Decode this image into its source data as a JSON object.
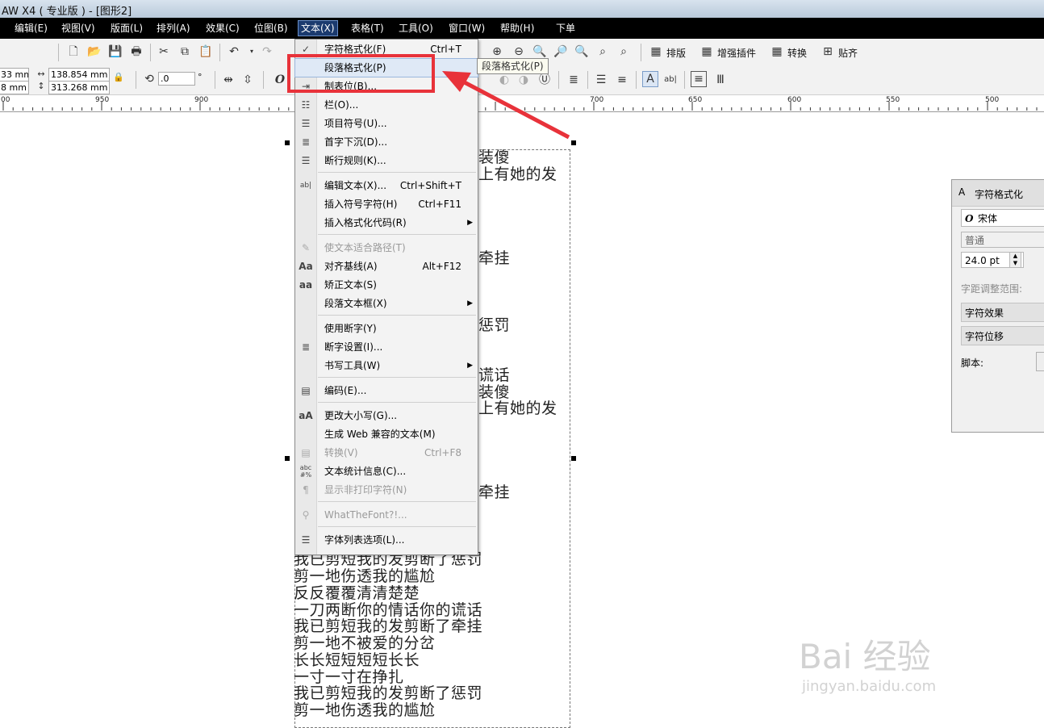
{
  "titlebar": {
    "title": "AW X4 ( 专业版 ) - [图形2]"
  },
  "menubar": {
    "items": [
      {
        "label": "编辑(E)"
      },
      {
        "label": "视图(V)"
      },
      {
        "label": "版面(L)"
      },
      {
        "label": "排列(A)"
      },
      {
        "label": "效果(C)"
      },
      {
        "label": "位图(B)"
      },
      {
        "label": "文本(X)"
      },
      {
        "label": "表格(T)"
      },
      {
        "label": "工具(O)"
      },
      {
        "label": "窗口(W)"
      },
      {
        "label": "帮助(H)"
      },
      {
        "label": "下单"
      }
    ]
  },
  "toolbar1": {
    "buttons": {
      "layout": "排版",
      "plugins": "增强插件",
      "convert": "转换",
      "snap": "贴齐"
    }
  },
  "toolbar2": {
    "pos_x": "33 mm",
    "pos_y": "8 mm",
    "width": "138.854 mm",
    "height": "313.268 mm",
    "rotation": ".0",
    "degree": "°"
  },
  "ruler": {
    "labels": [
      "00",
      "950",
      "900",
      "700",
      "650",
      "600",
      "550",
      "500"
    ]
  },
  "dropdown": {
    "items": [
      {
        "label": "字符格式化(F)",
        "shortcut": "Ctrl+T",
        "icon": "check-icon"
      },
      {
        "label": "段落格式化(P)",
        "shortcut": "",
        "icon": "paragraph-format-icon"
      },
      {
        "label": "制表位(B)...",
        "shortcut": "",
        "icon": "tab-stop-icon"
      },
      {
        "label": "栏(O)...",
        "shortcut": "",
        "icon": "columns-icon"
      },
      {
        "label": "项目符号(U)...",
        "shortcut": "",
        "icon": "bullets-icon"
      },
      {
        "label": "首字下沉(D)...",
        "shortcut": "",
        "icon": "drop-cap-icon"
      },
      {
        "label": "断行规则(K)...",
        "shortcut": "",
        "icon": "line-break-icon"
      },
      {
        "label": "编辑文本(X)...",
        "shortcut": "Ctrl+Shift+T",
        "icon": "edit-text-icon"
      },
      {
        "label": "插入符号字符(H)",
        "shortcut": "Ctrl+F11",
        "icon": ""
      },
      {
        "label": "插入格式化代码(R)",
        "shortcut": "",
        "icon": ""
      },
      {
        "label": "使文本适合路径(T)",
        "shortcut": "",
        "icon": "fit-path-icon"
      },
      {
        "label": "对齐基线(A)",
        "shortcut": "Alt+F12",
        "icon": "align-baseline-icon"
      },
      {
        "label": "矫正文本(S)",
        "shortcut": "",
        "icon": "straighten-text-icon"
      },
      {
        "label": "段落文本框(X)",
        "shortcut": "",
        "icon": ""
      },
      {
        "label": "使用断字(Y)",
        "shortcut": "",
        "icon": ""
      },
      {
        "label": "断字设置(I)...",
        "shortcut": "",
        "icon": "hyphenation-icon"
      },
      {
        "label": "书写工具(W)",
        "shortcut": "",
        "icon": ""
      },
      {
        "label": "编码(E)...",
        "shortcut": "",
        "icon": "encoding-icon"
      },
      {
        "label": "更改大小写(G)...",
        "shortcut": "",
        "icon": "change-case-icon"
      },
      {
        "label": "生成 Web 兼容的文本(M)",
        "shortcut": "",
        "icon": ""
      },
      {
        "label": "转换(V)",
        "shortcut": "Ctrl+F8",
        "icon": "convert-icon"
      },
      {
        "label": "文本统计信息(C)...",
        "shortcut": "",
        "icon": "statistics-icon"
      },
      {
        "label": "显示非打印字符(N)",
        "shortcut": "",
        "icon": "pilcrow-icon"
      },
      {
        "label": "WhatTheFont?!...",
        "shortcut": "",
        "icon": "whatthefont-icon"
      },
      {
        "label": "字体列表选项(L)...",
        "shortcut": "",
        "icon": "font-list-icon"
      }
    ]
  },
  "tooltip": {
    "text": "段落格式化(P)"
  },
  "document": {
    "lines_right": [
      "装傻",
      "上有她的发",
      "牵挂",
      "惩罚",
      "谎话",
      "装傻",
      "上有她的发",
      "牵挂"
    ],
    "lines_full": [
      "我已剪短我的发剪断了惩罚",
      "剪一地伤透我的尴尬",
      "反反覆覆清清楚楚",
      "一刀两断你的情话你的谎话",
      "我已剪短我的发剪断了牵挂",
      "剪一地不被爱的分岔",
      "长长短短短短长长",
      "一寸一寸在挣扎",
      "我已剪短我的发剪断了惩罚",
      "剪一地伤透我的尴尬"
    ]
  },
  "docker": {
    "title": "字符格式化",
    "font": "宋体",
    "style": "普通",
    "size": "24.0 pt",
    "kerning_label": "字距调整范围:",
    "effects": "字符效果",
    "offset": "字符位移",
    "script_label": "脚本:"
  },
  "watermark": {
    "text": "Bai 经验",
    "sub": "jingyan.baidu.com"
  }
}
